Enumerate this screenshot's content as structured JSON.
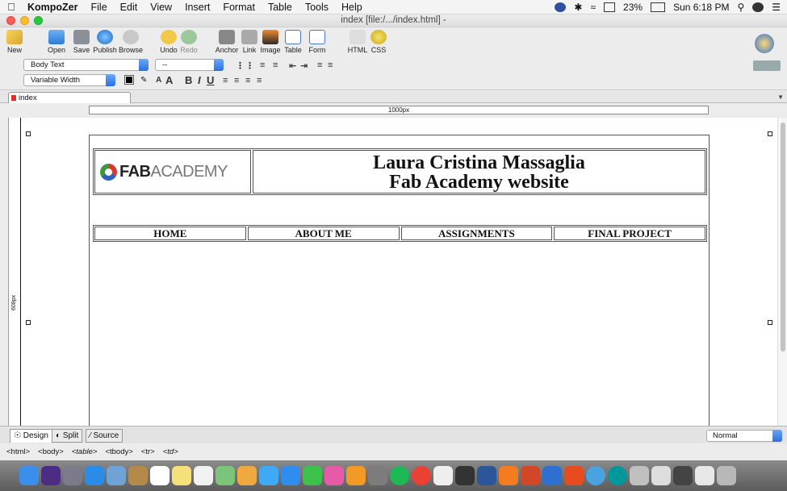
{
  "menubar": {
    "app_name": "KompoZer",
    "items": [
      "File",
      "Edit",
      "View",
      "Insert",
      "Format",
      "Table",
      "Tools",
      "Help"
    ],
    "battery": "23%",
    "clock": "Sun 6:18 PM"
  },
  "window": {
    "title": "index [file:/.../index.html] -"
  },
  "toolbar": {
    "new": "New",
    "open": "Open",
    "save": "Save",
    "publish": "Publish",
    "browse": "Browse",
    "undo": "Undo",
    "redo": "Redo",
    "anchor": "Anchor",
    "link": "Link",
    "image": "Image",
    "table": "Table",
    "form": "Form",
    "html": "HTML",
    "css": "CSS"
  },
  "format": {
    "paragraph_style": "Body Text",
    "font": "--",
    "width": "Variable Width",
    "b": "B",
    "i": "I",
    "u": "U"
  },
  "tabs": [
    {
      "label": "index"
    }
  ],
  "ruler": {
    "width_label": "1000px",
    "height_label": "608px"
  },
  "document": {
    "logo_fab": "FAB",
    "logo_academy": "ACADEMY",
    "title_line1": "Laura Cristina Massaglia",
    "title_line2": "Fab Academy website",
    "nav": [
      "HOME",
      "ABOUT ME",
      "ASSIGNMENTS",
      "FINAL PROJECT"
    ]
  },
  "modes": {
    "design": "Design",
    "split": "Split",
    "source": "Source"
  },
  "view_mode": "Normal",
  "status_tags": [
    "<html>",
    "<body>",
    "<table>",
    "<tbody>",
    "<tr>",
    "<td>"
  ],
  "colors": {
    "accent": "#2b6fe0",
    "close": "#fd5f57",
    "minimize": "#febc2e",
    "maximize": "#28c840"
  }
}
